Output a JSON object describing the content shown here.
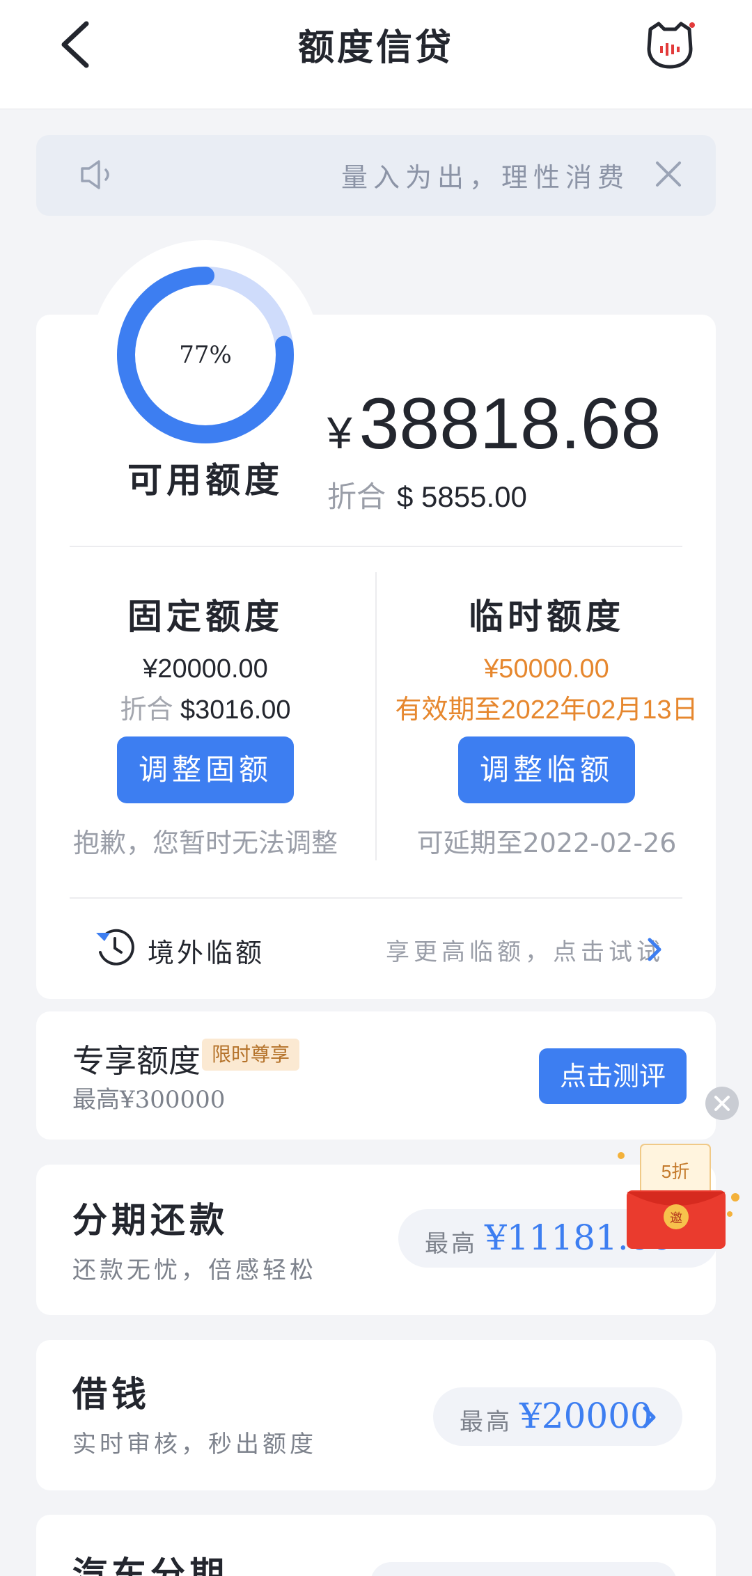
{
  "header": {
    "title": "额度信贷"
  },
  "notice": {
    "text": "量入为出，理性消费"
  },
  "available": {
    "percent_label": "77%",
    "percent": 0.77,
    "label": "可用额度",
    "currency_symbol": "¥",
    "amount": "38818.68",
    "usd_label": "折合",
    "usd_amount": "$ 5855.00"
  },
  "fixed": {
    "title": "固定额度",
    "amount": "¥20000.00",
    "usd_label": "折合",
    "usd_amount": "$3016.00",
    "button_label": "调整固额",
    "note": "抱歉，您暂时无法调整"
  },
  "temporary": {
    "title": "临时额度",
    "amount": "¥50000.00",
    "validity": "有效期至2022年02月13日",
    "button_label": "调整临额",
    "note": "可延期至2022-02-26"
  },
  "overseas": {
    "label": "境外临额",
    "hint": "享更高临额，点击试试"
  },
  "exclusive": {
    "title": "专享额度",
    "badge": "限时尊享",
    "subtitle": "最高¥300000",
    "button_label": "点击测评"
  },
  "services": [
    {
      "title": "分期还款",
      "subtitle": "还款无忧，倍感轻松",
      "max_label": "最高",
      "max_value": "¥11181.00"
    },
    {
      "title": "借钱",
      "subtitle": "实时审核，秒出额度",
      "max_label": "最高",
      "max_value": "¥20000"
    },
    {
      "title": "汽车分期"
    }
  ],
  "promo": {
    "discount": "5折",
    "seal": "邀"
  },
  "colors": {
    "accent": "#3d7ef1",
    "warning": "#e6872e",
    "ring_track": "#cfdcfb"
  }
}
